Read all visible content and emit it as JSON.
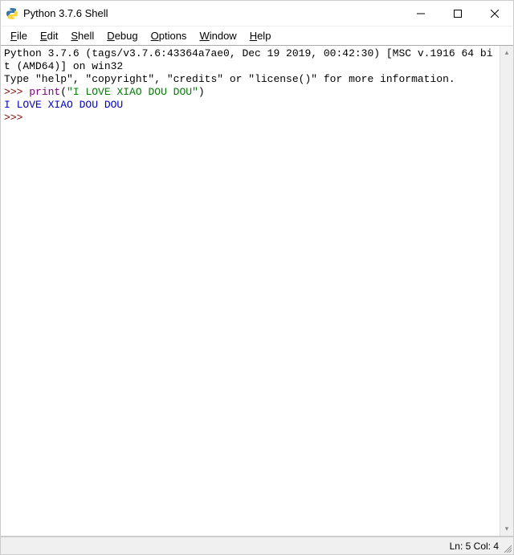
{
  "window": {
    "title": "Python 3.7.6 Shell"
  },
  "menu": {
    "file": "File",
    "edit": "Edit",
    "shell": "Shell",
    "debug": "Debug",
    "options": "Options",
    "window": "Window",
    "help": "Help"
  },
  "shell": {
    "banner_line1": "Python 3.7.6 (tags/v3.7.6:43364a7ae0, Dec 19 2019, 00:42:30) [MSC v.1916 64 bit (AMD64)] on win32",
    "banner_line2": "Type \"help\", \"copyright\", \"credits\" or \"license()\" for more information.",
    "prompt": ">>> ",
    "input_call": "print",
    "input_paren_open": "(",
    "input_string": "\"I LOVE XIAO DOU DOU\"",
    "input_paren_close": ")",
    "output": "I LOVE XIAO DOU DOU",
    "prompt2": ">>> "
  },
  "status": {
    "position": "Ln: 5  Col: 4"
  }
}
